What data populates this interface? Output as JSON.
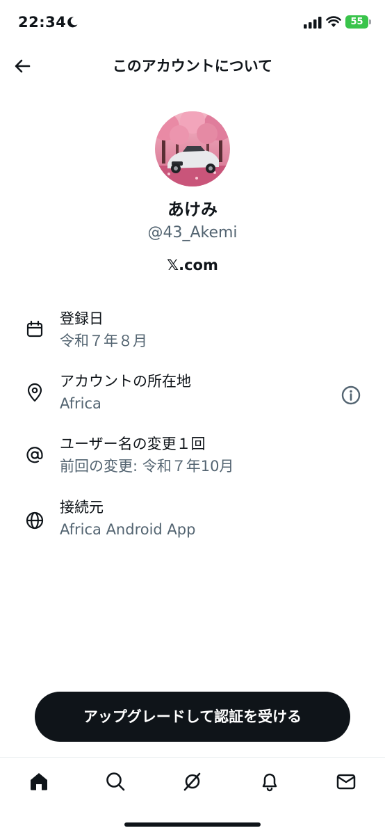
{
  "status_bar": {
    "time": "22:34",
    "battery_level": "55",
    "icons": [
      "moon-icon",
      "signal-icon",
      "wifi-icon",
      "battery-icon"
    ]
  },
  "header": {
    "title": "このアカウントについて",
    "back_icon": "arrow-left-icon"
  },
  "profile": {
    "display_name": "あけみ",
    "handle": "@43_Akemi",
    "domain": "𝕏.com"
  },
  "info_rows": [
    {
      "icon": "calendar-icon",
      "label": "登録日",
      "value": "令和７年８月"
    },
    {
      "icon": "location-pin-icon",
      "label": "アカウントの所在地",
      "value": "Africa",
      "action_icon": "info-icon"
    },
    {
      "icon": "at-sign-icon",
      "label": "ユーザー名の変更１回",
      "value": "前回の変更: 令和７年10月"
    },
    {
      "icon": "globe-icon",
      "label": "接続元",
      "value": "Africa Android App"
    }
  ],
  "cta": {
    "label": "アップグレードして認証を受ける"
  },
  "bottom_nav": {
    "items": [
      "home-icon",
      "search-icon",
      "grok-icon",
      "bell-icon",
      "mail-icon"
    ],
    "active": "home-icon"
  },
  "colors": {
    "text_primary": "#0f1419",
    "text_secondary": "#536471",
    "battery_green": "#39c44b",
    "cta_background": "#0f1419"
  }
}
